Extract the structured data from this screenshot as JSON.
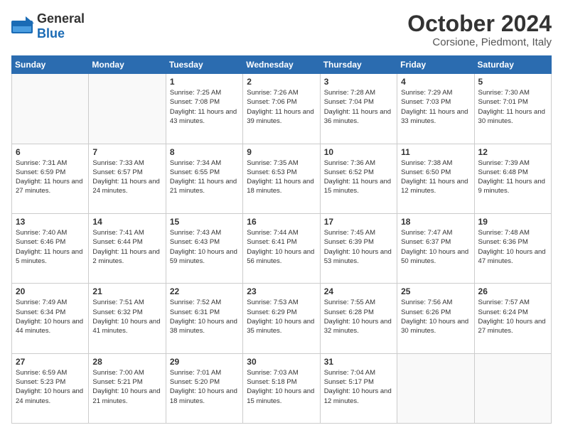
{
  "header": {
    "logo_general": "General",
    "logo_blue": "Blue",
    "month_title": "October 2024",
    "location": "Corsione, Piedmont, Italy"
  },
  "weekdays": [
    "Sunday",
    "Monday",
    "Tuesday",
    "Wednesday",
    "Thursday",
    "Friday",
    "Saturday"
  ],
  "weeks": [
    [
      {
        "day": "",
        "sunrise": "",
        "sunset": "",
        "daylight": ""
      },
      {
        "day": "",
        "sunrise": "",
        "sunset": "",
        "daylight": ""
      },
      {
        "day": "1",
        "sunrise": "Sunrise: 7:25 AM",
        "sunset": "Sunset: 7:08 PM",
        "daylight": "Daylight: 11 hours and 43 minutes."
      },
      {
        "day": "2",
        "sunrise": "Sunrise: 7:26 AM",
        "sunset": "Sunset: 7:06 PM",
        "daylight": "Daylight: 11 hours and 39 minutes."
      },
      {
        "day": "3",
        "sunrise": "Sunrise: 7:28 AM",
        "sunset": "Sunset: 7:04 PM",
        "daylight": "Daylight: 11 hours and 36 minutes."
      },
      {
        "day": "4",
        "sunrise": "Sunrise: 7:29 AM",
        "sunset": "Sunset: 7:03 PM",
        "daylight": "Daylight: 11 hours and 33 minutes."
      },
      {
        "day": "5",
        "sunrise": "Sunrise: 7:30 AM",
        "sunset": "Sunset: 7:01 PM",
        "daylight": "Daylight: 11 hours and 30 minutes."
      }
    ],
    [
      {
        "day": "6",
        "sunrise": "Sunrise: 7:31 AM",
        "sunset": "Sunset: 6:59 PM",
        "daylight": "Daylight: 11 hours and 27 minutes."
      },
      {
        "day": "7",
        "sunrise": "Sunrise: 7:33 AM",
        "sunset": "Sunset: 6:57 PM",
        "daylight": "Daylight: 11 hours and 24 minutes."
      },
      {
        "day": "8",
        "sunrise": "Sunrise: 7:34 AM",
        "sunset": "Sunset: 6:55 PM",
        "daylight": "Daylight: 11 hours and 21 minutes."
      },
      {
        "day": "9",
        "sunrise": "Sunrise: 7:35 AM",
        "sunset": "Sunset: 6:53 PM",
        "daylight": "Daylight: 11 hours and 18 minutes."
      },
      {
        "day": "10",
        "sunrise": "Sunrise: 7:36 AM",
        "sunset": "Sunset: 6:52 PM",
        "daylight": "Daylight: 11 hours and 15 minutes."
      },
      {
        "day": "11",
        "sunrise": "Sunrise: 7:38 AM",
        "sunset": "Sunset: 6:50 PM",
        "daylight": "Daylight: 11 hours and 12 minutes."
      },
      {
        "day": "12",
        "sunrise": "Sunrise: 7:39 AM",
        "sunset": "Sunset: 6:48 PM",
        "daylight": "Daylight: 11 hours and 9 minutes."
      }
    ],
    [
      {
        "day": "13",
        "sunrise": "Sunrise: 7:40 AM",
        "sunset": "Sunset: 6:46 PM",
        "daylight": "Daylight: 11 hours and 5 minutes."
      },
      {
        "day": "14",
        "sunrise": "Sunrise: 7:41 AM",
        "sunset": "Sunset: 6:44 PM",
        "daylight": "Daylight: 11 hours and 2 minutes."
      },
      {
        "day": "15",
        "sunrise": "Sunrise: 7:43 AM",
        "sunset": "Sunset: 6:43 PM",
        "daylight": "Daylight: 10 hours and 59 minutes."
      },
      {
        "day": "16",
        "sunrise": "Sunrise: 7:44 AM",
        "sunset": "Sunset: 6:41 PM",
        "daylight": "Daylight: 10 hours and 56 minutes."
      },
      {
        "day": "17",
        "sunrise": "Sunrise: 7:45 AM",
        "sunset": "Sunset: 6:39 PM",
        "daylight": "Daylight: 10 hours and 53 minutes."
      },
      {
        "day": "18",
        "sunrise": "Sunrise: 7:47 AM",
        "sunset": "Sunset: 6:37 PM",
        "daylight": "Daylight: 10 hours and 50 minutes."
      },
      {
        "day": "19",
        "sunrise": "Sunrise: 7:48 AM",
        "sunset": "Sunset: 6:36 PM",
        "daylight": "Daylight: 10 hours and 47 minutes."
      }
    ],
    [
      {
        "day": "20",
        "sunrise": "Sunrise: 7:49 AM",
        "sunset": "Sunset: 6:34 PM",
        "daylight": "Daylight: 10 hours and 44 minutes."
      },
      {
        "day": "21",
        "sunrise": "Sunrise: 7:51 AM",
        "sunset": "Sunset: 6:32 PM",
        "daylight": "Daylight: 10 hours and 41 minutes."
      },
      {
        "day": "22",
        "sunrise": "Sunrise: 7:52 AM",
        "sunset": "Sunset: 6:31 PM",
        "daylight": "Daylight: 10 hours and 38 minutes."
      },
      {
        "day": "23",
        "sunrise": "Sunrise: 7:53 AM",
        "sunset": "Sunset: 6:29 PM",
        "daylight": "Daylight: 10 hours and 35 minutes."
      },
      {
        "day": "24",
        "sunrise": "Sunrise: 7:55 AM",
        "sunset": "Sunset: 6:28 PM",
        "daylight": "Daylight: 10 hours and 32 minutes."
      },
      {
        "day": "25",
        "sunrise": "Sunrise: 7:56 AM",
        "sunset": "Sunset: 6:26 PM",
        "daylight": "Daylight: 10 hours and 30 minutes."
      },
      {
        "day": "26",
        "sunrise": "Sunrise: 7:57 AM",
        "sunset": "Sunset: 6:24 PM",
        "daylight": "Daylight: 10 hours and 27 minutes."
      }
    ],
    [
      {
        "day": "27",
        "sunrise": "Sunrise: 6:59 AM",
        "sunset": "Sunset: 5:23 PM",
        "daylight": "Daylight: 10 hours and 24 minutes."
      },
      {
        "day": "28",
        "sunrise": "Sunrise: 7:00 AM",
        "sunset": "Sunset: 5:21 PM",
        "daylight": "Daylight: 10 hours and 21 minutes."
      },
      {
        "day": "29",
        "sunrise": "Sunrise: 7:01 AM",
        "sunset": "Sunset: 5:20 PM",
        "daylight": "Daylight: 10 hours and 18 minutes."
      },
      {
        "day": "30",
        "sunrise": "Sunrise: 7:03 AM",
        "sunset": "Sunset: 5:18 PM",
        "daylight": "Daylight: 10 hours and 15 minutes."
      },
      {
        "day": "31",
        "sunrise": "Sunrise: 7:04 AM",
        "sunset": "Sunset: 5:17 PM",
        "daylight": "Daylight: 10 hours and 12 minutes."
      },
      {
        "day": "",
        "sunrise": "",
        "sunset": "",
        "daylight": ""
      },
      {
        "day": "",
        "sunrise": "",
        "sunset": "",
        "daylight": ""
      }
    ]
  ]
}
